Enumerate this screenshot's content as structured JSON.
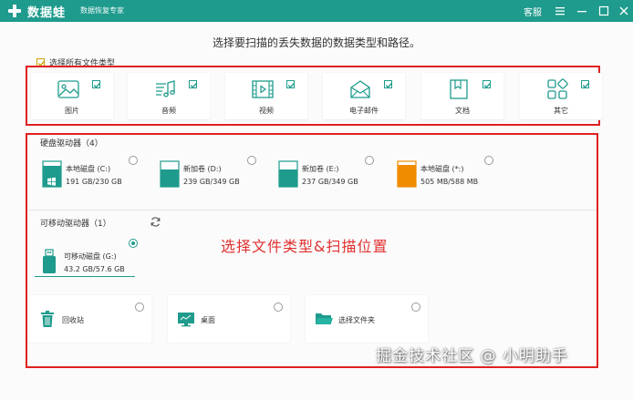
{
  "app": {
    "brand_name": "数据蛙",
    "brand_subtitle": "数据恢复专家",
    "service_label": "客服",
    "accent_color": "#1f9b8d"
  },
  "headline": "选择要扫描的丢失数据的数据类型和路径。",
  "select_all": {
    "label": "选择所有文件类型",
    "checked": true
  },
  "file_types": [
    {
      "label": "图片",
      "icon": "image-icon",
      "checked": true
    },
    {
      "label": "音频",
      "icon": "audio-icon",
      "checked": true
    },
    {
      "label": "视频",
      "icon": "video-icon",
      "checked": true
    },
    {
      "label": "电子邮件",
      "icon": "email-icon",
      "checked": true
    },
    {
      "label": "文档",
      "icon": "document-icon",
      "checked": true
    },
    {
      "label": "其它",
      "icon": "other-icon",
      "checked": true
    }
  ],
  "hard_drives": {
    "title": "硬盘驱动器（4）",
    "items": [
      {
        "name": "本地磁盘 (C:)",
        "size": "191 GB/230 GB",
        "fill": 0.83,
        "color": "#1f9b8d",
        "selected": false
      },
      {
        "name": "新加卷 (D:)",
        "size": "239 GB/349 GB",
        "fill": 0.68,
        "color": "#1f9b8d",
        "selected": false
      },
      {
        "name": "新加卷 (E:)",
        "size": "237 GB/349 GB",
        "fill": 0.68,
        "color": "#1f9b8d",
        "selected": false
      },
      {
        "name": "本地磁盘 (*:)",
        "size": "505 MB/588 MB",
        "fill": 0.86,
        "color": "#f08c00",
        "selected": false
      }
    ]
  },
  "removable_drives": {
    "title": "可移动驱动器（1）",
    "items": [
      {
        "name": "可移动磁盘 (G:)",
        "size": "43.2 GB/57.6 GB",
        "selected": true
      }
    ]
  },
  "locations": [
    {
      "label": "回收站",
      "icon": "recycle-bin-icon",
      "selected": false
    },
    {
      "label": "桌面",
      "icon": "desktop-icon",
      "selected": false
    },
    {
      "label": "选择文件夹",
      "icon": "folder-icon",
      "selected": false
    }
  ],
  "annotation": "选择文件类型&扫描位置",
  "watermark": "掘金技术社区 @ 小明助手"
}
